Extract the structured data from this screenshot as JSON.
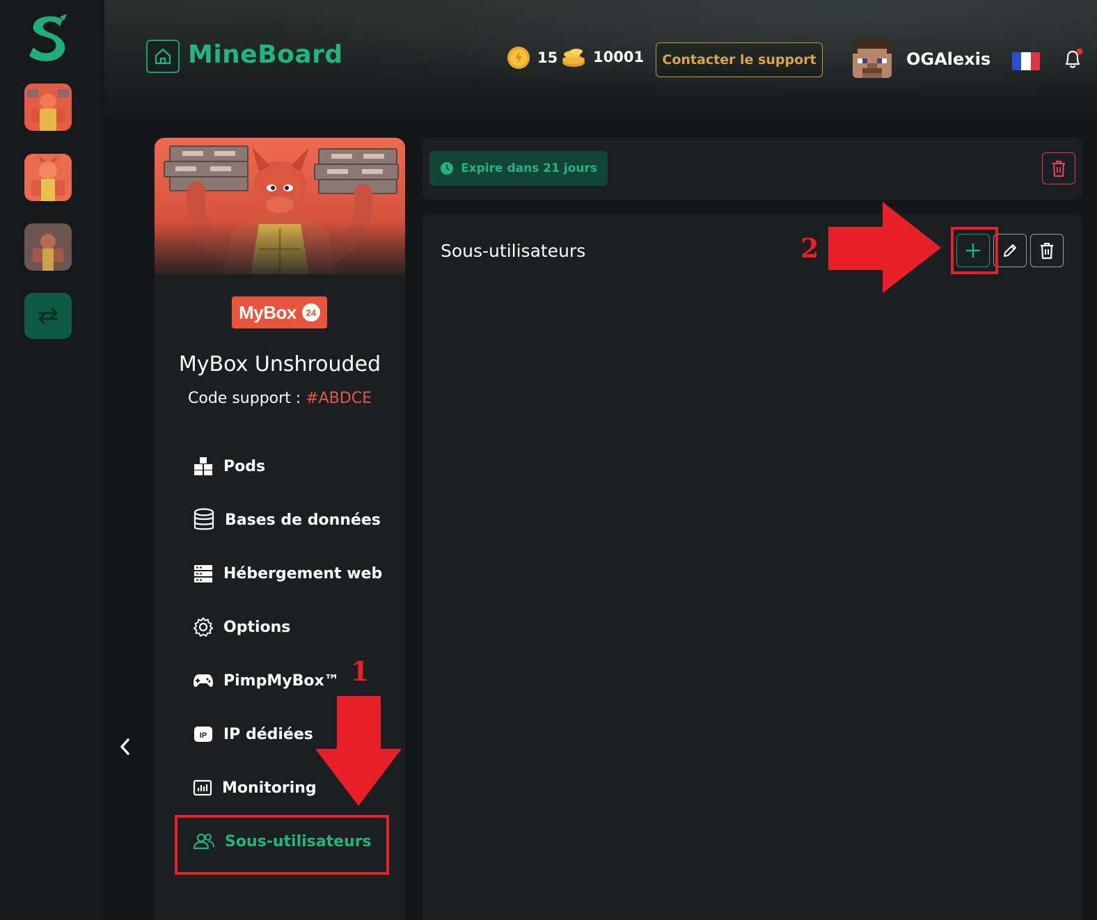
{
  "app": {
    "brand": "MineBoard"
  },
  "header": {
    "coins_count": "15",
    "credits_count": "10001",
    "support_label": "Contacter le support",
    "username": "OGAlexis",
    "language": "fr"
  },
  "server": {
    "badge_text": "MyBox",
    "badge_num": "24",
    "name": "MyBox Unshrouded",
    "support_code_label": "Code support :",
    "support_code": "#ABDCE"
  },
  "menu": {
    "items": [
      {
        "label": "Pods",
        "icon": "pods-icon"
      },
      {
        "label": "Bases de données",
        "icon": "database-icon"
      },
      {
        "label": "Hébergement web",
        "icon": "server-icon"
      },
      {
        "label": "Options",
        "icon": "gear-icon"
      },
      {
        "label": "PimpMyBox™",
        "icon": "gamepad-icon"
      },
      {
        "label": "IP dédiées",
        "icon": "ip-icon"
      },
      {
        "label": "Monitoring",
        "icon": "chart-icon"
      },
      {
        "label": "Sous-utilisateurs",
        "icon": "users-icon",
        "active": true
      }
    ]
  },
  "status": {
    "expire_label": "Expire dans 21 jours"
  },
  "content": {
    "title": "Sous-utilisateurs"
  },
  "annotations": {
    "step1": "1",
    "step2": "2"
  },
  "colors": {
    "accent": "#22b57e",
    "danger": "#e0405a",
    "annotation": "#e8202a",
    "support": "#d8a64a"
  }
}
